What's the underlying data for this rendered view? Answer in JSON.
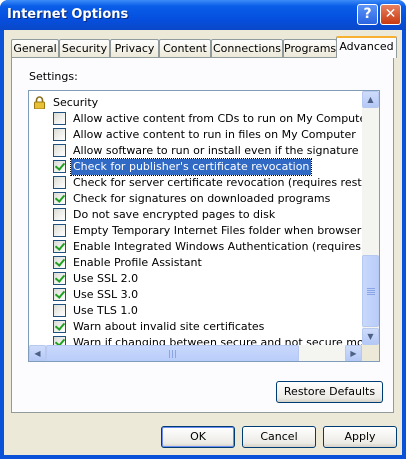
{
  "window": {
    "title": "Internet Options",
    "help_glyph": "?",
    "close_glyph": "✕"
  },
  "tabs": [
    {
      "label": "General"
    },
    {
      "label": "Security"
    },
    {
      "label": "Privacy"
    },
    {
      "label": "Content"
    },
    {
      "label": "Connections"
    },
    {
      "label": "Programs"
    },
    {
      "label": "Advanced",
      "active": true
    }
  ],
  "settings_label": "Settings:",
  "group_header": "Security",
  "items": [
    {
      "label": "Allow active content from CDs to run on My Computer",
      "checked": false
    },
    {
      "label": "Allow active content to run in files on My Computer",
      "checked": false
    },
    {
      "label": "Allow software to run or install even if the signature is invalid",
      "checked": false
    },
    {
      "label": "Check for publisher's certificate revocation",
      "checked": true,
      "selected": true
    },
    {
      "label": "Check for server certificate revocation (requires restart)",
      "checked": false
    },
    {
      "label": "Check for signatures on downloaded programs",
      "checked": true
    },
    {
      "label": "Do not save encrypted pages to disk",
      "checked": false
    },
    {
      "label": "Empty Temporary Internet Files folder when browser is closed",
      "checked": false
    },
    {
      "label": "Enable Integrated Windows Authentication (requires restart)",
      "checked": true
    },
    {
      "label": "Enable Profile Assistant",
      "checked": true
    },
    {
      "label": "Use SSL 2.0",
      "checked": true
    },
    {
      "label": "Use SSL 3.0",
      "checked": true
    },
    {
      "label": "Use TLS 1.0",
      "checked": false
    },
    {
      "label": "Warn about invalid site certificates",
      "checked": true
    },
    {
      "label": "Warn if changing between secure and not secure mode",
      "checked": true
    }
  ],
  "scroll_glyphs": {
    "up": "▲",
    "down": "▼",
    "left": "◀",
    "right": "▶"
  },
  "buttons": {
    "restore_defaults": "Restore Defaults",
    "ok": "OK",
    "cancel": "Cancel",
    "apply": "Apply"
  },
  "colors": {
    "selection": "#316ac5",
    "titlebar": "#0550e0",
    "face": "#ece9d8",
    "checkmark": "#21a121"
  }
}
